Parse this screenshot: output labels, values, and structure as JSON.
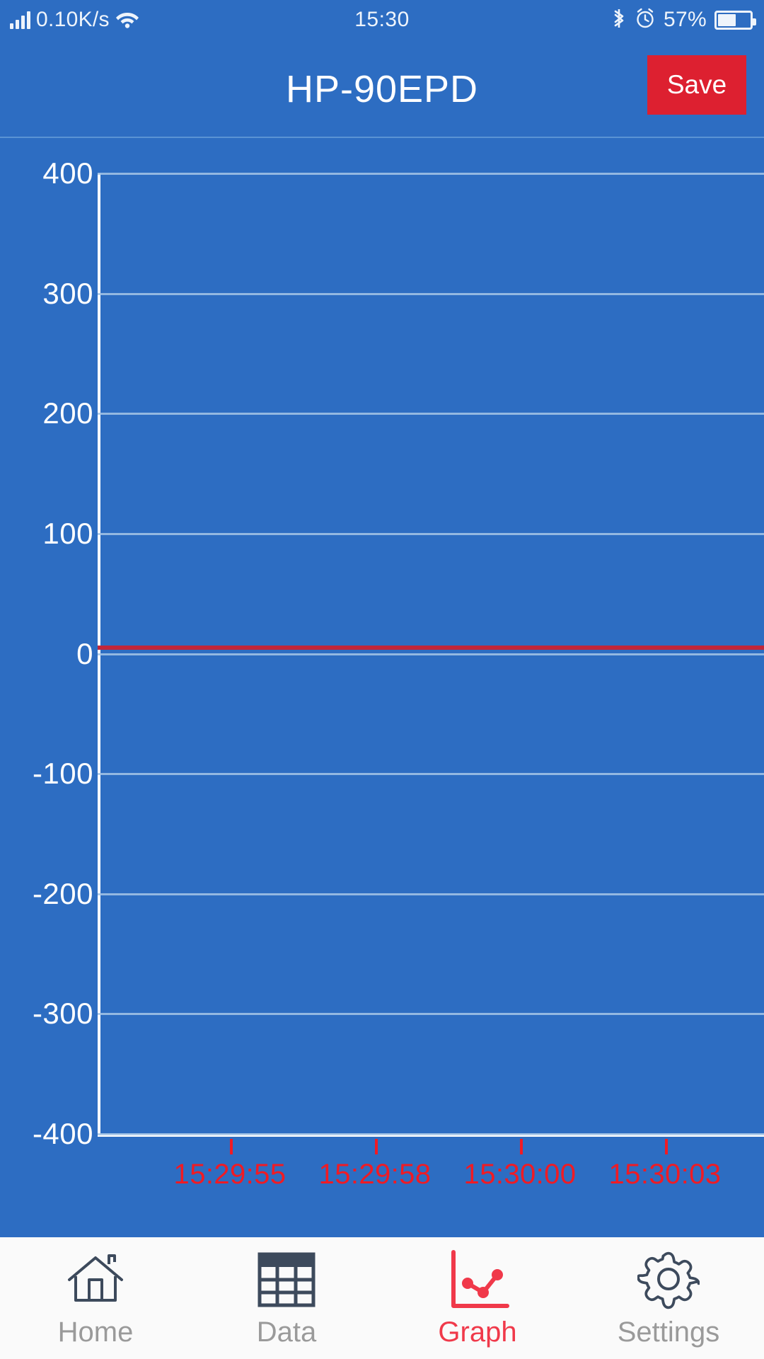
{
  "statusbar": {
    "network_speed": "0.10K/s",
    "clock": "15:30",
    "battery_percent": "57%",
    "icons": {
      "signal": "signal-bars-icon",
      "wifi": "wifi-icon",
      "bluetooth": "bluetooth-icon",
      "alarm": "alarm-clock-icon",
      "battery": "battery-icon"
    }
  },
  "header": {
    "title": "HP-90EPD",
    "save_label": "Save",
    "save_color": "#dd2030"
  },
  "chart_data": {
    "type": "line",
    "title": "",
    "xlabel": "",
    "ylabel": "",
    "ylim": [
      -400,
      400
    ],
    "yticks": [
      400,
      300,
      200,
      100,
      0,
      -100,
      -200,
      -300,
      -400
    ],
    "ytick_labels": [
      "400",
      "300",
      "200",
      "100",
      "0",
      "-100",
      "-200",
      "-300",
      "-400"
    ],
    "xtick_labels": [
      "15:29:55",
      "15:29:58",
      "15:30:00",
      "15:30:03"
    ],
    "grid": true,
    "legend": "none",
    "axis_color": "#ffffff",
    "grid_color": "#a6c6e6",
    "series": [
      {
        "name": "reading",
        "color": "#c0263a",
        "x": [
          "15:29:55",
          "15:29:58",
          "15:30:00",
          "15:30:03"
        ],
        "values": [
          5,
          5,
          5,
          5
        ]
      }
    ],
    "background": "#2d6dc2",
    "xtick_color": "#f01b24"
  },
  "tabbar": {
    "items": [
      {
        "label": "Home",
        "icon": "home-icon",
        "active": false
      },
      {
        "label": "Data",
        "icon": "table-grid-icon",
        "active": false
      },
      {
        "label": "Graph",
        "icon": "line-chart-icon",
        "active": true
      },
      {
        "label": "Settings",
        "icon": "gear-icon",
        "active": false
      }
    ],
    "active_color": "#f0394a",
    "inactive_color": "#9a9a9a"
  }
}
